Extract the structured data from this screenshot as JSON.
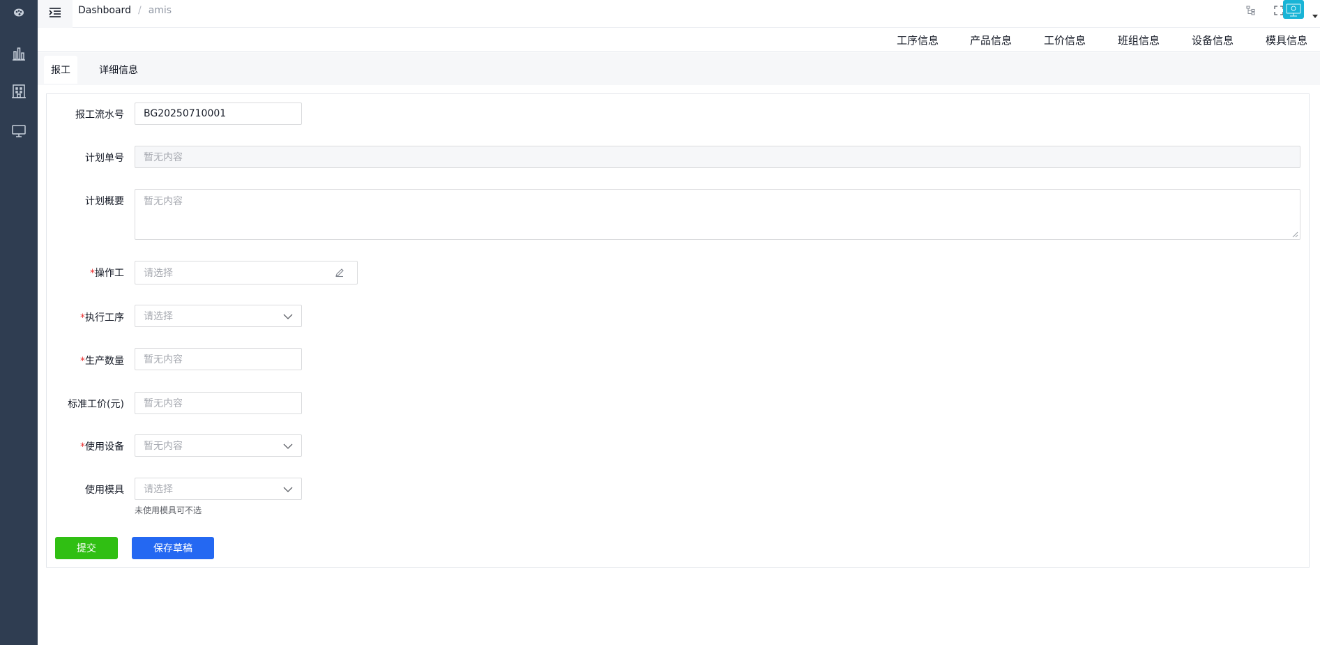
{
  "header": {
    "breadcrumb": {
      "home": "Dashboard",
      "separator": "/",
      "current": "amis"
    },
    "icons": [
      "sitemap-icon",
      "fullscreen-icon",
      "avatar-icon"
    ]
  },
  "sidebar": {
    "logo_icon": "palette-icon",
    "items": [
      {
        "icon": "bar-chart-icon"
      },
      {
        "icon": "building-icon"
      },
      {
        "icon": "monitor-icon"
      }
    ]
  },
  "info_nav": {
    "items": [
      "工序信息",
      "产品信息",
      "工价信息",
      "班组信息",
      "设备信息",
      "模具信息"
    ]
  },
  "tabs": [
    {
      "label": "报工",
      "active": true
    },
    {
      "label": "详细信息",
      "active": false
    }
  ],
  "form": {
    "report_no": {
      "label": "报工流水号",
      "value": "BG20250710001",
      "required": false
    },
    "plan_no": {
      "label": "计划单号",
      "placeholder": "暂无内容",
      "required": false,
      "disabled": true
    },
    "plan_summary": {
      "label": "计划概要",
      "placeholder": "暂无内容",
      "required": false
    },
    "operator": {
      "label": "操作工",
      "placeholder": "请选择",
      "required": true,
      "required_mark": "*"
    },
    "process": {
      "label": "执行工序",
      "placeholder": "请选择",
      "required": true,
      "required_mark": "*"
    },
    "quantity": {
      "label": "生产数量",
      "placeholder": "暂无内容",
      "required": true,
      "required_mark": "*"
    },
    "std_price": {
      "label": "标准工价(元)",
      "placeholder": "暂无内容",
      "required": false
    },
    "equipment": {
      "label": "使用设备",
      "placeholder": "暂无内容",
      "required": true,
      "required_mark": "*"
    },
    "mold": {
      "label": "使用模具",
      "placeholder": "请选择",
      "required": false,
      "hint": "未使用模具可不选"
    }
  },
  "actions": {
    "submit_label": "提交",
    "draft_label": "保存草稿"
  },
  "colors": {
    "sidebar_bg": "#2f3d51",
    "submit": "#30bf13",
    "draft": "#2468f2",
    "required": "#ea2e2e",
    "avatar": "#19b4d6"
  }
}
